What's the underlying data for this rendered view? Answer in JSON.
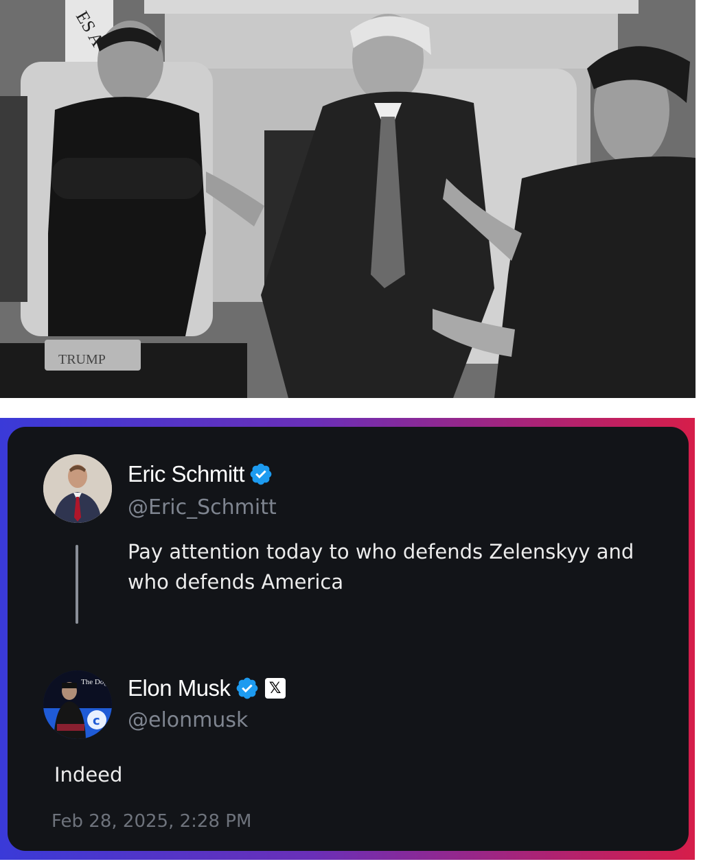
{
  "photo": {
    "plaque_text": "TRUMP",
    "flag_text": "ES A"
  },
  "quoted_tweet": {
    "author_name": "Eric Schmitt",
    "handle": "@Eric_Schmitt",
    "verified": true,
    "text": "Pay attention today to who defends Zelenskyy and who defends America"
  },
  "reply_tweet": {
    "author_name": "Elon Musk",
    "handle": "@elonmusk",
    "verified": true,
    "affiliation_badge": "𝕏",
    "avatar_text": "The Dogefa",
    "text": "Indeed",
    "timestamp": "Feb 28, 2025, 2:28 PM"
  },
  "colors": {
    "card_bg": "#121418",
    "verified_blue": "#1d9bf0",
    "frame_left": "#3a3ad8",
    "frame_right": "#d61e4a"
  },
  "icons": [
    "verified-badge-icon",
    "x-logo-icon"
  ]
}
